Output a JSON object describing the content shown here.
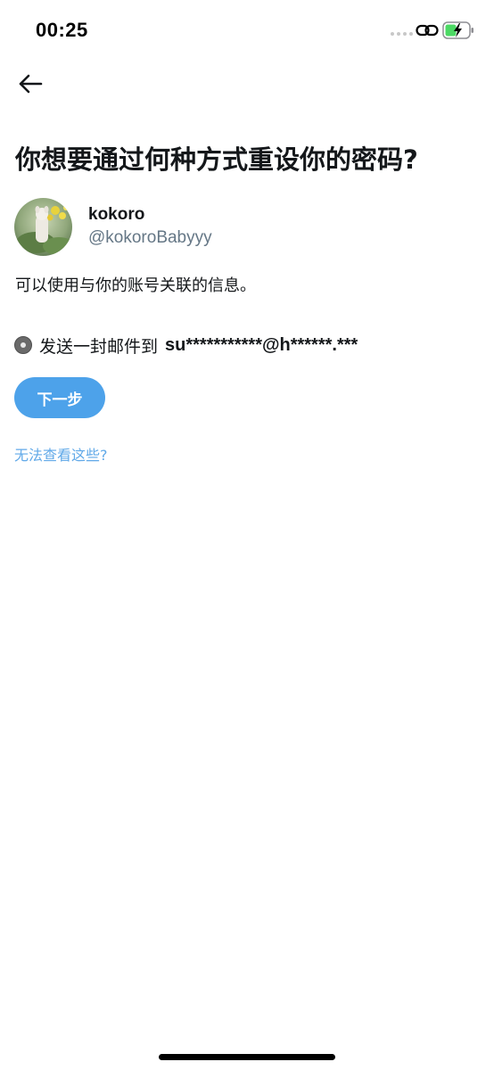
{
  "status_bar": {
    "time": "00:25",
    "icons": [
      "signal-dots-icon",
      "link-icon",
      "battery-charging-icon"
    ],
    "battery_color": "#4cd964"
  },
  "nav": {
    "back_icon": "arrow-left-icon"
  },
  "page": {
    "title": "你想要通过何种方式重设你的密码?"
  },
  "account": {
    "display_name": "kokoro",
    "handle": "@kokoroBabyyy"
  },
  "info_text": "可以使用与你的账号关联的信息。",
  "option": {
    "label": "发送一封邮件到",
    "email": "su***********@h******.***",
    "selected": true
  },
  "actions": {
    "next_label": "下一步",
    "help_link": "无法查看这些?"
  },
  "colors": {
    "accent": "#4da2ea",
    "link": "#61a9e8",
    "secondary_text": "#657786"
  }
}
